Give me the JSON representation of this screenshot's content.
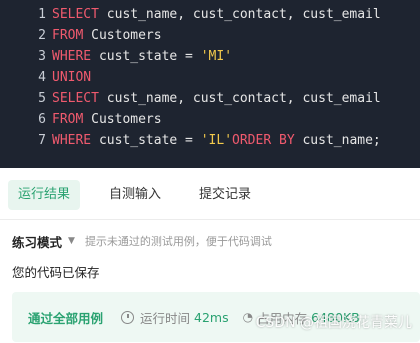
{
  "code": {
    "lines": [
      [
        {
          "t": "kw",
          "v": "SELECT"
        },
        {
          "t": "txt",
          "v": " cust_name, cust_contact, cust_email"
        }
      ],
      [
        {
          "t": "kw",
          "v": "FROM"
        },
        {
          "t": "txt",
          "v": " Customers"
        }
      ],
      [
        {
          "t": "kw",
          "v": "WHERE"
        },
        {
          "t": "txt",
          "v": " cust_state = "
        },
        {
          "t": "str",
          "v": "'MI'"
        }
      ],
      [
        {
          "t": "kw",
          "v": "UNION"
        }
      ],
      [
        {
          "t": "kw",
          "v": "SELECT"
        },
        {
          "t": "txt",
          "v": " cust_name, cust_contact, cust_email"
        }
      ],
      [
        {
          "t": "kw",
          "v": "FROM"
        },
        {
          "t": "txt",
          "v": " Customers"
        }
      ],
      [
        {
          "t": "kw",
          "v": "WHERE"
        },
        {
          "t": "txt",
          "v": " cust_state = "
        },
        {
          "t": "str",
          "v": "'IL'"
        },
        {
          "t": "kw",
          "v": "ORDER BY"
        },
        {
          "t": "txt",
          "v": " cust_name;"
        }
      ]
    ]
  },
  "tabs": {
    "run_result": "运行结果",
    "self_test": "自测输入",
    "submit_record": "提交记录"
  },
  "mode": {
    "label": "练习模式",
    "hint": "提示未通过的测试用例，便于代码调试"
  },
  "saved_text": "您的代码已保存",
  "result": {
    "status": "通过全部用例",
    "run_time_label": "运行时间",
    "run_time": "42ms",
    "memory_label": "占用内存",
    "memory": "6480KB"
  },
  "watermark": "CSDN @祖国浇花青菜儿",
  "colors": {
    "editor_bg": "#1e2430",
    "keyword": "#f05a6e",
    "string": "#f2c94c",
    "accent": "#2aa271"
  }
}
